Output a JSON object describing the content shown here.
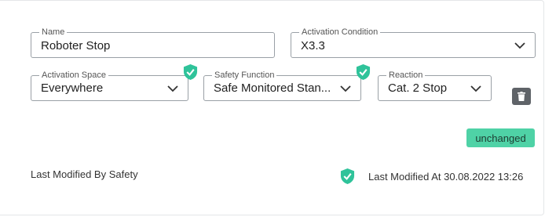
{
  "fields": {
    "name": {
      "legend": "Name",
      "value": "Roboter Stop"
    },
    "activation_condition": {
      "legend": "Activation Condition",
      "value": "X3.3"
    },
    "activation_space": {
      "legend": "Activation Space",
      "value": "Everywhere"
    },
    "safety_function": {
      "legend": "Safety Function",
      "value": "Safe Monitored Stan..."
    },
    "reaction": {
      "legend": "Reaction",
      "value": "Cat. 2 Stop"
    }
  },
  "status_badge": "unchanged",
  "footer": {
    "last_modified_by": "Last Modified By Safety",
    "last_modified_at": "Last Modified At 30.08.2022 13:26"
  },
  "icons": {
    "shield": "shield-check-icon",
    "chevron": "chevron-down-icon",
    "trash": "trash-icon"
  },
  "colors": {
    "shield_green": "#2fc39a",
    "badge_green": "#4fd2a6",
    "trash_gray": "#5f6368"
  }
}
